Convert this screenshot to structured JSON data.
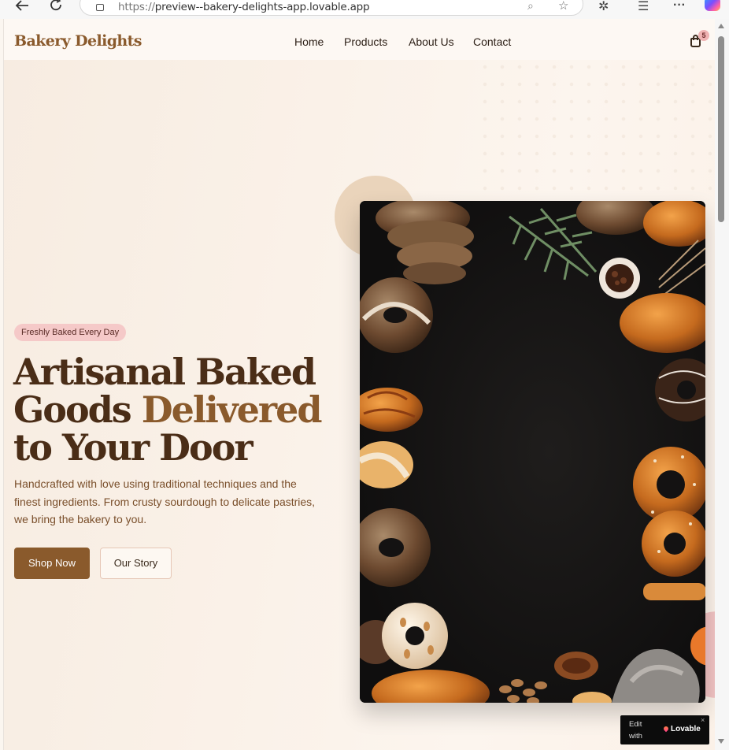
{
  "browser": {
    "url_protocol": "https://",
    "url_rest": "preview--bakery-delights-app.lovable.app",
    "back_icon": "arrow-left",
    "reload_icon": "reload",
    "menu_label": "···"
  },
  "header": {
    "logo": "Bakery Delights",
    "nav": [
      "Home",
      "Products",
      "About Us",
      "Contact"
    ],
    "cart_count": "5"
  },
  "hero": {
    "badge": "Freshly Baked Every Day",
    "title_line1": "Artisanal Baked",
    "title_line2_a": "Goods ",
    "title_line2_b": "Delivered",
    "title_line3": "to Your Door",
    "description": "Handcrafted with love using traditional techniques and the finest ingredients. From crusty sourdough to delicate pastries, we bring the bakery to you.",
    "primary_button": "Shop Now",
    "secondary_button": "Our Story"
  },
  "lovable_badge": {
    "edit_text": "Edit with",
    "brand": "Lovable",
    "close": "×"
  },
  "colors": {
    "brand_brown": "#8a5a2c",
    "heading_dark": "#4a2d17",
    "badge_pink": "#f5c9c8"
  }
}
